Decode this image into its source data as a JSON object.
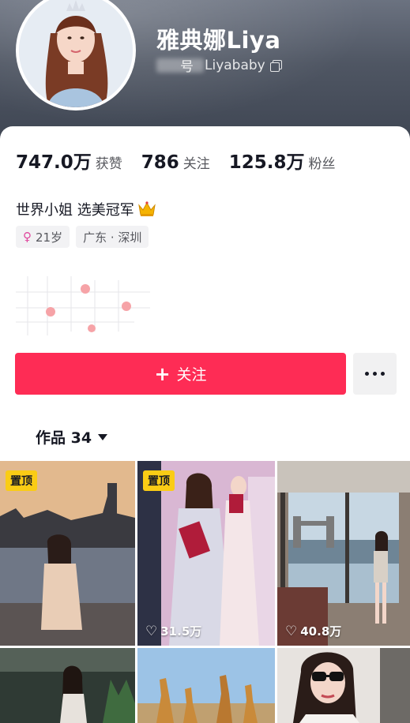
{
  "profile": {
    "name": "雅典娜Liya",
    "handle_label": "号",
    "handle_value": "Liyababy"
  },
  "stats": [
    {
      "value": "747.0万",
      "label": "获赞"
    },
    {
      "value": "786",
      "label": "关注"
    },
    {
      "value": "125.8万",
      "label": "粉丝"
    }
  ],
  "bio": {
    "text": "世界小姐 选美冠军"
  },
  "tags": [
    {
      "icon": "female-icon",
      "text": "21岁"
    },
    {
      "text": "广东 · 深圳"
    }
  ],
  "actions": {
    "follow_label": "关注",
    "follow_color": "#fe2c55"
  },
  "tabs": {
    "works_label": "作品 34"
  },
  "grid": [
    {
      "pinned": true,
      "pin_label": "置顶",
      "likes": ""
    },
    {
      "pinned": true,
      "pin_label": "置顶",
      "likes": "31.5万"
    },
    {
      "pinned": false,
      "pin_label": "",
      "likes": "40.8万"
    },
    {
      "pinned": false,
      "pin_label": "",
      "likes": ""
    },
    {
      "pinned": false,
      "pin_label": "",
      "likes": ""
    },
    {
      "pinned": false,
      "pin_label": "",
      "likes": ""
    }
  ]
}
